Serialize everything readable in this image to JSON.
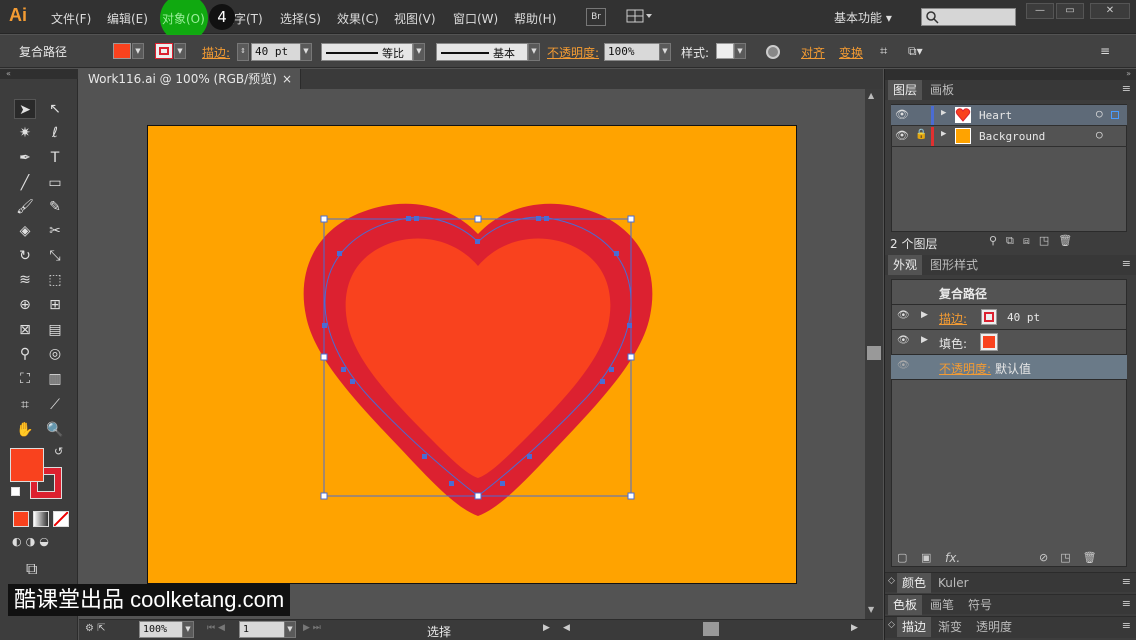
{
  "app": {
    "logo": "Ai"
  },
  "menu": [
    "文件(F)",
    "编辑(E)",
    "对象(O)",
    "文字(T)",
    "选择(S)",
    "效果(C)",
    "视图(V)",
    "窗口(W)",
    "帮助(H)"
  ],
  "tooltip_badge": "4",
  "bridge_button": "Br",
  "workspace": "基本功能 ▾",
  "window_buttons": [
    "—",
    "▭",
    "✕"
  ],
  "control": {
    "object_type": "复合路径",
    "stroke_label": "描边:",
    "stroke_weight": "40 pt",
    "profile_label": "等比",
    "brush_label": "基本",
    "opacity_label": "不透明度:",
    "opacity_value": "100%",
    "style_label": "样式:",
    "align_label": "对齐",
    "transform_label": "变换"
  },
  "document_tab": {
    "title": "Work116.ai @ 100% (RGB/预览)",
    "close": "×"
  },
  "colors": {
    "fill": "#f9421e",
    "stroke": "#dc2130",
    "artboard": "#ffa300",
    "selection": "#4a6cd4"
  },
  "layers_panel": {
    "tabs": [
      "图层",
      "画板"
    ],
    "layers": [
      {
        "name": "Heart",
        "color": "#4a6cd4",
        "thumb": "#f9421e",
        "locked": false
      },
      {
        "name": "Background",
        "color": "#e03030",
        "thumb": "#ffa300",
        "locked": true
      }
    ],
    "count": "2 个图层"
  },
  "appearance_panel": {
    "tabs": [
      "外观",
      "图形样式"
    ],
    "title": "复合路径",
    "stroke_label": "描边:",
    "stroke_value": "40 pt",
    "fill_label": "填色:",
    "opacity_label": "不透明度:",
    "opacity_value": "默认值",
    "fx": "fx."
  },
  "collapsed_panels": [
    [
      "颜色",
      "Kuler"
    ],
    [
      "色板",
      "画笔",
      "符号"
    ],
    [
      "描边",
      "渐变",
      "透明度"
    ]
  ],
  "status": {
    "zoom": "100%",
    "page": "1",
    "tool": "选择"
  },
  "watermark": "酷课堂出品 coolketang.com"
}
